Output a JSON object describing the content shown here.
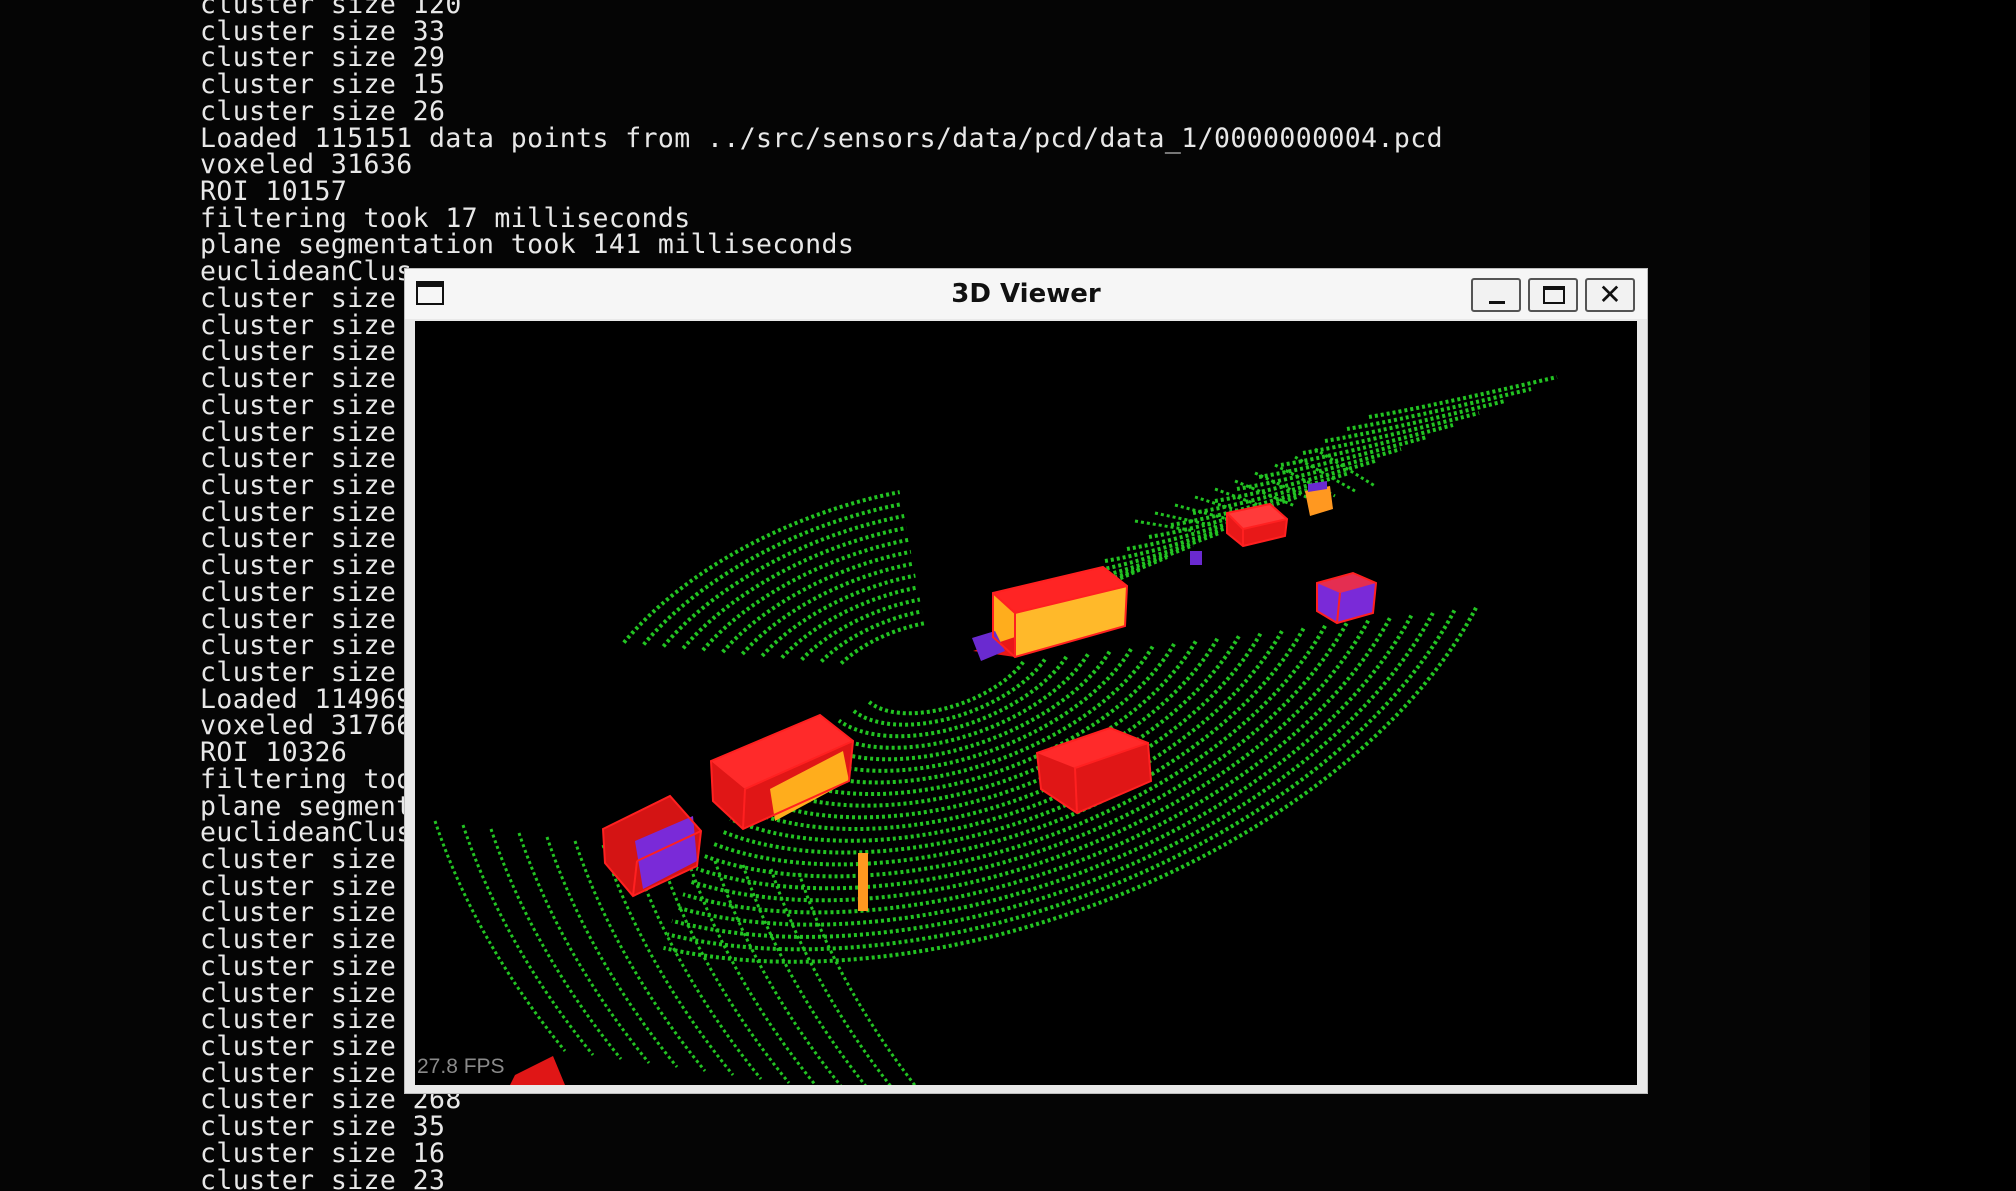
{
  "terminal": {
    "lines": [
      "cluster size 120",
      "cluster size 33",
      "cluster size 29",
      "cluster size 15",
      "cluster size 26",
      "Loaded 115151 data points from ../src/sensors/data/pcd/data_1/0000000004.pcd",
      "voxeled 31636",
      "ROI 10157",
      "filtering took 17 milliseconds",
      "plane segmentation took 141 milliseconds",
      "euclideanClus",
      "cluster size",
      "cluster size",
      "cluster size",
      "cluster size",
      "cluster size",
      "cluster size",
      "cluster size",
      "cluster size",
      "cluster size",
      "cluster size",
      "cluster size",
      "cluster size",
      "cluster size",
      "cluster size",
      "cluster size",
      "Loaded 114969",
      "voxeled 31766",
      "ROI 10326",
      "filtering too",
      "plane segment",
      "euclideanClus",
      "cluster size",
      "cluster size",
      "cluster size",
      "cluster size",
      "cluster size",
      "cluster size",
      "cluster size",
      "cluster size",
      "cluster size",
      "cluster size 268",
      "cluster size 35",
      "cluster size 16",
      "cluster size 23"
    ]
  },
  "viewer": {
    "title": "3D Viewer",
    "fps_label": "27.8 FPS"
  },
  "colors": {
    "road_points": "#22c322",
    "box_frame": "#ff2020",
    "cluster_fill": "#ffb020",
    "cluster_alt": "#6a2ad0"
  },
  "icons": {
    "window": "window-icon",
    "minimize": "minimize-icon",
    "maximize": "maximize-icon",
    "close": "close-icon"
  }
}
